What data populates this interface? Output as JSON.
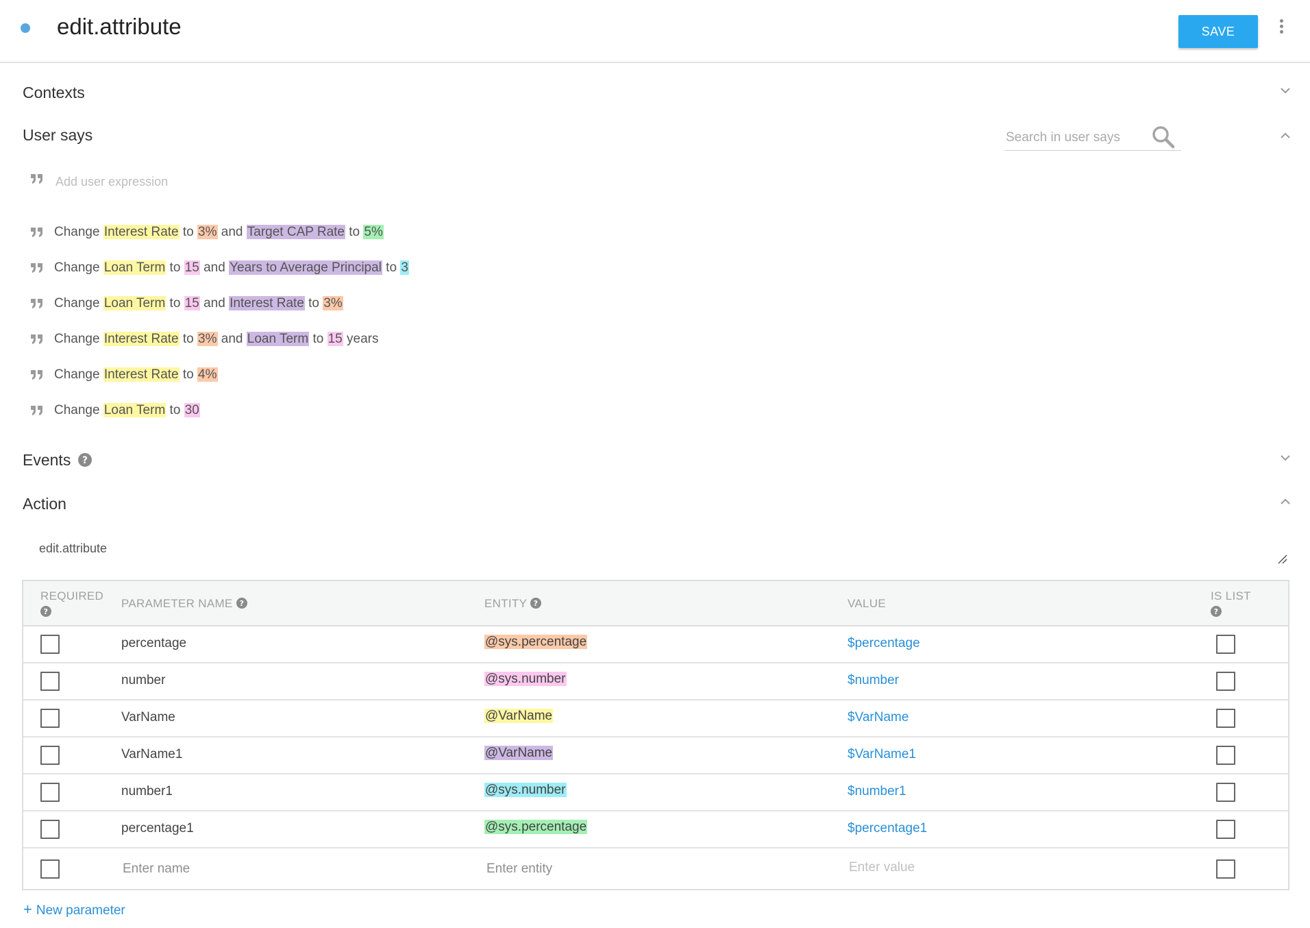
{
  "header": {
    "title": "edit.attribute",
    "save_label": "SAVE"
  },
  "sections": {
    "contexts": "Contexts",
    "user_says": "User says",
    "events": "Events",
    "action": "Action"
  },
  "search": {
    "placeholder": "Search in user says"
  },
  "add_expression": {
    "placeholder": "Add user expression"
  },
  "expressions": [
    [
      {
        "t": "Change "
      },
      {
        "t": "Interest Rate",
        "c": "yellow"
      },
      {
        "t": " to "
      },
      {
        "t": "3%",
        "c": "orange"
      },
      {
        "t": " and "
      },
      {
        "t": "Target CAP Rate",
        "c": "purple"
      },
      {
        "t": " to "
      },
      {
        "t": "5%",
        "c": "green"
      }
    ],
    [
      {
        "t": "Change "
      },
      {
        "t": "Loan Term",
        "c": "yellow"
      },
      {
        "t": " to "
      },
      {
        "t": "15",
        "c": "pink"
      },
      {
        "t": " and "
      },
      {
        "t": "Years to Average Principal",
        "c": "purple"
      },
      {
        "t": " to "
      },
      {
        "t": "3",
        "c": "cyan"
      }
    ],
    [
      {
        "t": "Change "
      },
      {
        "t": "Loan Term",
        "c": "yellow"
      },
      {
        "t": " to "
      },
      {
        "t": "15",
        "c": "pink"
      },
      {
        "t": " and "
      },
      {
        "t": "Interest Rate",
        "c": "purple"
      },
      {
        "t": " to "
      },
      {
        "t": "3%",
        "c": "orange"
      }
    ],
    [
      {
        "t": "Change "
      },
      {
        "t": "Interest Rate",
        "c": "yellow"
      },
      {
        "t": " to "
      },
      {
        "t": "3%",
        "c": "orange"
      },
      {
        "t": " and "
      },
      {
        "t": "Loan Term",
        "c": "purple"
      },
      {
        "t": " to "
      },
      {
        "t": "15",
        "c": "pink"
      },
      {
        "t": " years"
      }
    ],
    [
      {
        "t": "Change "
      },
      {
        "t": "Interest Rate",
        "c": "yellow"
      },
      {
        "t": " to "
      },
      {
        "t": "4%",
        "c": "orange"
      }
    ],
    [
      {
        "t": "Change "
      },
      {
        "t": "Loan Term",
        "c": "yellow"
      },
      {
        "t": " to "
      },
      {
        "t": "30",
        "c": "pink"
      }
    ]
  ],
  "action": {
    "name": "edit.attribute"
  },
  "table": {
    "headers": {
      "required": "REQUIRED",
      "parameter_name": "PARAMETER NAME",
      "entity": "ENTITY",
      "value": "VALUE",
      "is_list": "IS LIST"
    },
    "rows": [
      {
        "name": "percentage",
        "entity": "@sys.percentage",
        "entity_color": "orange",
        "value": "$percentage"
      },
      {
        "name": "number",
        "entity": "@sys.number",
        "entity_color": "pink",
        "value": "$number"
      },
      {
        "name": "VarName",
        "entity": "@VarName",
        "entity_color": "yellow",
        "value": "$VarName"
      },
      {
        "name": "VarName1",
        "entity": "@VarName",
        "entity_color": "purple",
        "value": "$VarName1"
      },
      {
        "name": "number1",
        "entity": "@sys.number",
        "entity_color": "cyan",
        "value": "$number1"
      },
      {
        "name": "percentage1",
        "entity": "@sys.percentage",
        "entity_color": "green",
        "value": "$percentage1"
      }
    ],
    "new_row": {
      "name_placeholder": "Enter name",
      "entity_placeholder": "Enter entity",
      "value_placeholder": "Enter value"
    }
  },
  "new_parameter_label": "New parameter",
  "colors": {
    "accent": "#29a8ef",
    "link": "#2a8fd8",
    "status_dot": "#5aa6e0"
  },
  "icons": [
    "status-dot",
    "more-vert-icon",
    "chevron-down-icon",
    "chevron-up-icon",
    "search-icon",
    "quote-icon",
    "help-icon",
    "resize-icon",
    "plus-icon"
  ]
}
